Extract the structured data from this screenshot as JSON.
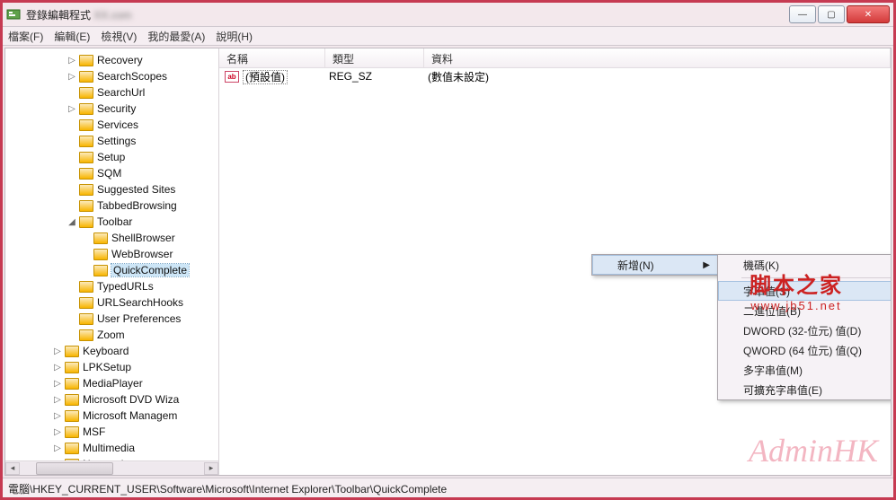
{
  "window": {
    "title": "登錄編輯程式",
    "blurred_suffix": "XX.com"
  },
  "menu": {
    "file": "檔案(F)",
    "edit": "編輯(E)",
    "view": "檢視(V)",
    "favorites": "我的最愛(A)",
    "help": "說明(H)"
  },
  "tree": [
    {
      "level": 4,
      "exp": "▷",
      "label": "Recovery"
    },
    {
      "level": 4,
      "exp": "▷",
      "label": "SearchScopes"
    },
    {
      "level": 4,
      "exp": "",
      "label": "SearchUrl"
    },
    {
      "level": 4,
      "exp": "▷",
      "label": "Security"
    },
    {
      "level": 4,
      "exp": "",
      "label": "Services"
    },
    {
      "level": 4,
      "exp": "",
      "label": "Settings"
    },
    {
      "level": 4,
      "exp": "",
      "label": "Setup"
    },
    {
      "level": 4,
      "exp": "",
      "label": "SQM"
    },
    {
      "level": 4,
      "exp": "",
      "label": "Suggested Sites"
    },
    {
      "level": 4,
      "exp": "",
      "label": "TabbedBrowsing"
    },
    {
      "level": 4,
      "exp": "◢",
      "label": "Toolbar"
    },
    {
      "level": 5,
      "exp": "",
      "label": "ShellBrowser"
    },
    {
      "level": 5,
      "exp": "",
      "label": "WebBrowser"
    },
    {
      "level": 5,
      "exp": "",
      "label": "QuickComplete",
      "selected": true
    },
    {
      "level": 4,
      "exp": "",
      "label": "TypedURLs"
    },
    {
      "level": 4,
      "exp": "",
      "label": "URLSearchHooks"
    },
    {
      "level": 4,
      "exp": "",
      "label": "User Preferences"
    },
    {
      "level": 4,
      "exp": "",
      "label": "Zoom"
    },
    {
      "level": 3,
      "exp": "▷",
      "label": "Keyboard"
    },
    {
      "level": 3,
      "exp": "▷",
      "label": "LPKSetup"
    },
    {
      "level": 3,
      "exp": "▷",
      "label": "MediaPlayer"
    },
    {
      "level": 3,
      "exp": "▷",
      "label": "Microsoft DVD Wiza"
    },
    {
      "level": 3,
      "exp": "▷",
      "label": "Microsoft Managem"
    },
    {
      "level": 3,
      "exp": "▷",
      "label": "MSF"
    },
    {
      "level": 3,
      "exp": "▷",
      "label": "Multimedia"
    },
    {
      "level": 3,
      "exp": "▷",
      "label": "Notepad"
    }
  ],
  "columns": {
    "name": "名稱",
    "type": "類型",
    "data": "資料"
  },
  "rows": [
    {
      "icon": "ab",
      "name": "(預設值)",
      "type": "REG_SZ",
      "data": "(數值未設定)"
    }
  ],
  "context1": {
    "new": "新增(N)"
  },
  "context2": [
    {
      "label": "機碼(K)",
      "sep_after": true
    },
    {
      "label": "字串值(S)",
      "hover": true
    },
    {
      "label": "二進位值(B)"
    },
    {
      "label": "DWORD (32-位元) 值(D)"
    },
    {
      "label": "QWORD (64 位元) 值(Q)"
    },
    {
      "label": "多字串值(M)"
    },
    {
      "label": "可擴充字串值(E)"
    }
  ],
  "statusbar": "電腦\\HKEY_CURRENT_USER\\Software\\Microsoft\\Internet Explorer\\Toolbar\\QuickComplete",
  "watermark1": {
    "big": "脚本之家",
    "small": "www.jb51.net"
  },
  "watermark2": "AdminHK"
}
